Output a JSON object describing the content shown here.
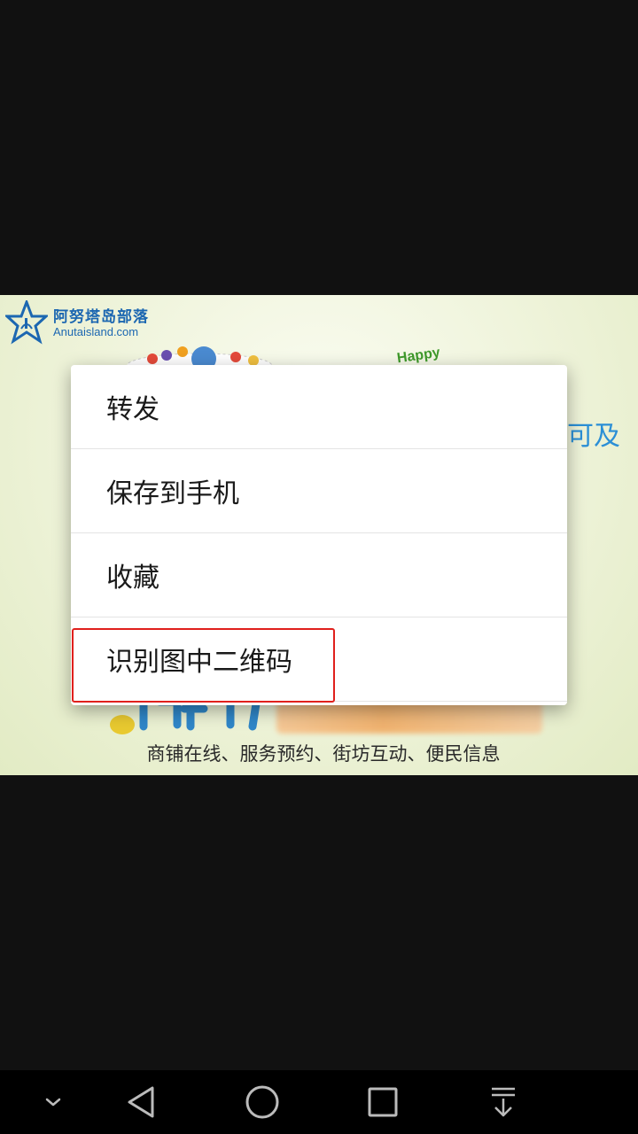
{
  "promo": {
    "logo_name": "阿努塔岛部落",
    "logo_url": "Anutaisland.com",
    "happy": "Happy",
    "partial_text": "可及",
    "tagline": "商铺在线、服务预约、街坊互动、便民信息"
  },
  "menu": {
    "items": [
      {
        "label": "转发"
      },
      {
        "label": "保存到手机"
      },
      {
        "label": "收藏"
      },
      {
        "label": "识别图中二维码"
      }
    ]
  },
  "navbar": {
    "buttons": [
      {
        "icon": "chevron-down-icon"
      },
      {
        "icon": "back-icon"
      },
      {
        "icon": "home-icon"
      },
      {
        "icon": "recents-icon"
      },
      {
        "icon": "pull-down-icon"
      }
    ]
  },
  "colors": {
    "highlight": "#e0201c",
    "logo_blue": "#1c67b1",
    "navbar_bg": "#000000"
  }
}
